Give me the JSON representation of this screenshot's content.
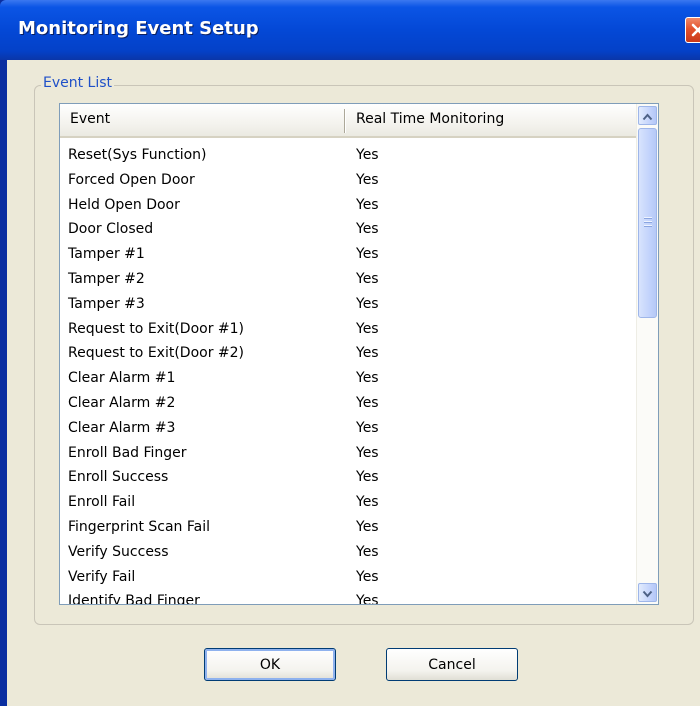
{
  "window": {
    "title": "Monitoring Event Setup"
  },
  "group": {
    "label": "Event List"
  },
  "list": {
    "columns": [
      "Event",
      "Real Time Monitoring"
    ],
    "rows": [
      [
        "Reset(Sys Function)",
        "Yes"
      ],
      [
        "Forced Open Door",
        "Yes"
      ],
      [
        "Held Open Door",
        "Yes"
      ],
      [
        "Door Closed",
        "Yes"
      ],
      [
        "Tamper #1",
        "Yes"
      ],
      [
        "Tamper #2",
        "Yes"
      ],
      [
        "Tamper #3",
        "Yes"
      ],
      [
        "Request to Exit(Door #1)",
        "Yes"
      ],
      [
        "Request to Exit(Door #2)",
        "Yes"
      ],
      [
        "Clear Alarm #1",
        "Yes"
      ],
      [
        "Clear Alarm #2",
        "Yes"
      ],
      [
        "Clear Alarm #3",
        "Yes"
      ],
      [
        "Enroll Bad Finger",
        "Yes"
      ],
      [
        "Enroll Success",
        "Yes"
      ],
      [
        "Enroll Fail",
        "Yes"
      ],
      [
        "Fingerprint Scan Fail",
        "Yes"
      ],
      [
        "Verify Success",
        "Yes"
      ],
      [
        "Verify Fail",
        "Yes"
      ],
      [
        "Identify Bad Finger",
        "Yes"
      ]
    ]
  },
  "buttons": {
    "ok": "OK",
    "cancel": "Cancel"
  },
  "icons": {
    "close": "close-icon",
    "scroll_up": "chevron-up-icon",
    "scroll_down": "chevron-down-icon"
  },
  "colors": {
    "titlebar": "#0448d6",
    "close_button": "#e2522d",
    "group_label": "#1f50c8",
    "dialog_background": "#ece9d8"
  }
}
